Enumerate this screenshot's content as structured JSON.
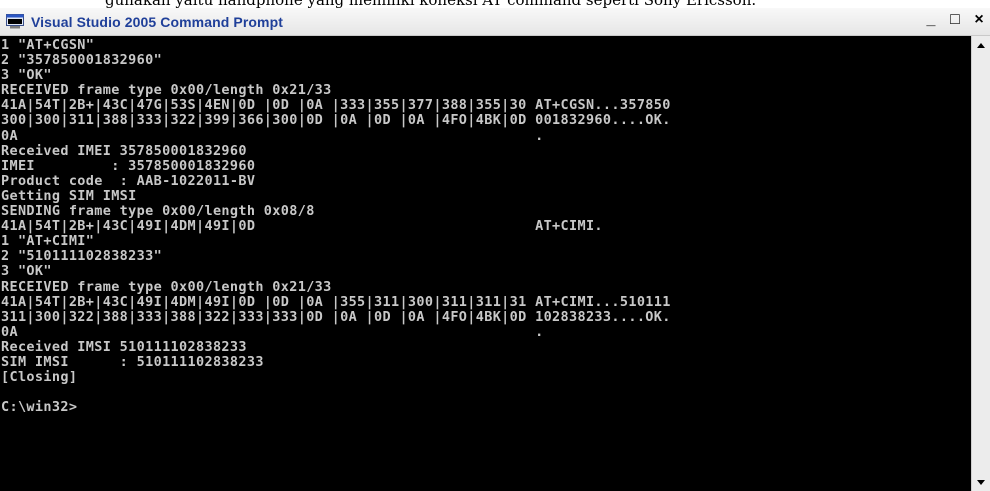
{
  "document_caption": "gunakan yaitu handphone yang memiliki koneksi AT command seperti Sony Ericsson.",
  "window": {
    "title": "Visual Studio 2005 Command Prompt",
    "icon": "console-window-icon",
    "controls": {
      "minimize": "_",
      "maximize": "□",
      "close": "×"
    }
  },
  "console": {
    "lines": [
      "1 \"AT+CGSN\"",
      "2 \"357850001832960\"",
      "3 \"OK\"",
      "RECEIVED frame type 0x00/length 0x21/33",
      "41A|54T|2B+|43C|47G|53S|4EN|0D |0D |0A |333|355|377|388|355|30 AT+CGSN...357850",
      "300|300|311|388|333|322|399|366|300|0D |0A |0D |0A |4FO|4BK|0D 001832960....OK.",
      "0A                                                             .",
      "Received IMEI 357850001832960",
      "IMEI         : 357850001832960",
      "Product code  : AAB-1022011-BV",
      "Getting SIM IMSI",
      "SENDING frame type 0x00/length 0x08/8",
      "41A|54T|2B+|43C|49I|4DM|49I|0D                                 AT+CIMI.",
      "1 \"AT+CIMI\"",
      "2 \"510111102838233\"",
      "3 \"OK\"",
      "RECEIVED frame type 0x00/length 0x21/33",
      "41A|54T|2B+|43C|49I|4DM|49I|0D |0D |0A |355|311|300|311|311|31 AT+CIMI...510111",
      "311|300|322|388|333|388|322|333|333|0D |0A |0D |0A |4FO|4BK|0D 102838233....OK.",
      "0A                                                             .",
      "Received IMSI 510111102838233",
      "SIM IMSI      : 510111102838233",
      "[Closing]",
      "",
      "C:\\win32>"
    ]
  },
  "scrollbar": {
    "up_icon": "scroll-up-arrow-icon",
    "down_icon": "scroll-down-arrow-icon"
  }
}
